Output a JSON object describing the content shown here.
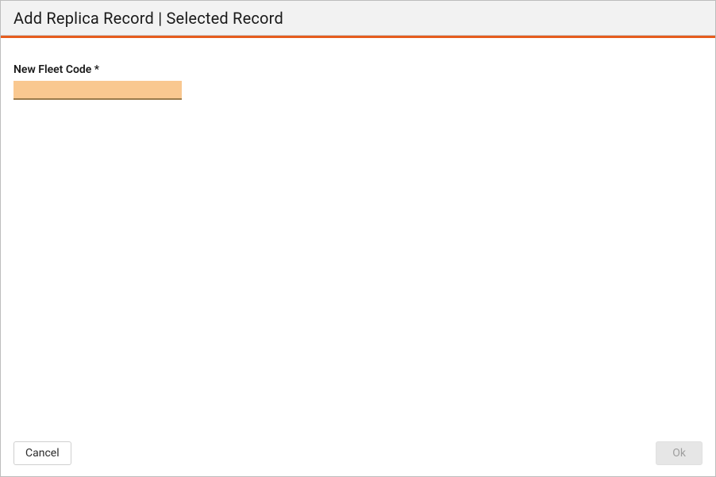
{
  "dialog": {
    "title": "Add Replica Record | Selected Record"
  },
  "form": {
    "fleet_code_label": "New Fleet Code *",
    "fleet_code_value": ""
  },
  "footer": {
    "cancel_label": "Cancel",
    "ok_label": "Ok"
  },
  "colors": {
    "accent": "#e65d1e",
    "input_highlight": "#f9c890"
  }
}
